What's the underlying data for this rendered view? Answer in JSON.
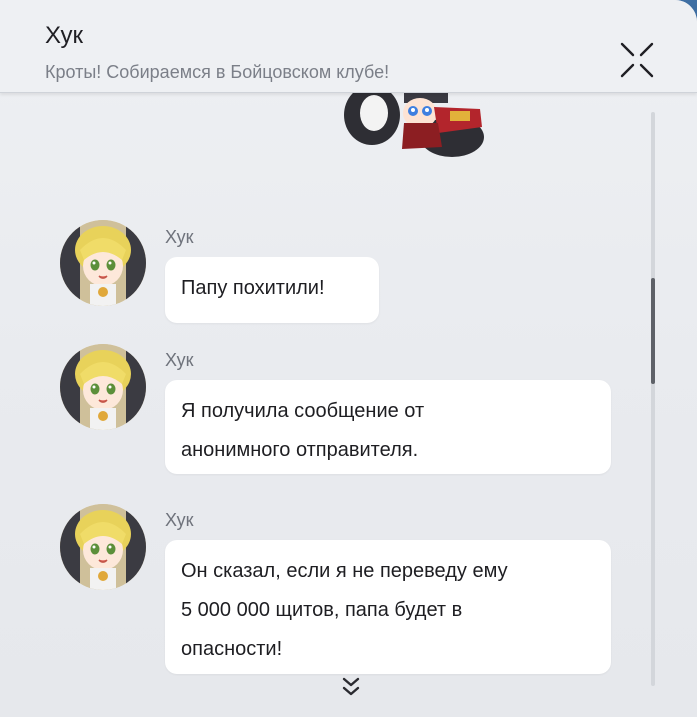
{
  "header": {
    "title": "Хук",
    "subtitle": "Кроты! Собираемся в Бойцовском клубе!",
    "close_icon": "close-icon"
  },
  "messages": [
    {
      "sender": "Хук",
      "lines": [
        "Папу похитили!"
      ]
    },
    {
      "sender": "Хук",
      "lines": [
        "Я получила сообщение от",
        "анонимного отправителя."
      ]
    },
    {
      "sender": "Хук",
      "lines": [
        "Он сказал, если я не переведу ему",
        "5 000 000 щитов, папа будет в",
        "опасности!"
      ]
    }
  ],
  "scroll_down_icon": "chevron-double-down-icon",
  "colors": {
    "panel_bg": "#eceef1",
    "bubble_bg": "#ffffff",
    "text": "#1e1e22",
    "muted": "#7b7f88"
  }
}
